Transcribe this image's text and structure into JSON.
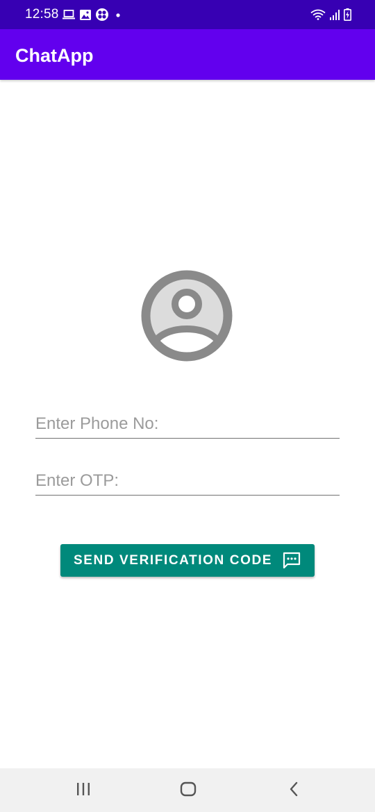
{
  "status_bar": {
    "time": "12:58",
    "left_icons": [
      "laptop-icon",
      "image-icon",
      "app-icon",
      "dot-icon"
    ],
    "right_icons": [
      "wifi-icon",
      "signal-icon",
      "battery-charging-icon"
    ]
  },
  "app_bar": {
    "title": "ChatApp"
  },
  "avatar": {
    "icon": "account-circle-icon"
  },
  "form": {
    "phone_placeholder": "Enter Phone No:",
    "phone_value": "",
    "otp_placeholder": "Enter OTP:",
    "otp_value": ""
  },
  "button": {
    "label": "SEND VERIFICATION CODE",
    "icon": "sms-icon"
  },
  "nav_bar": {
    "buttons": [
      "recents-icon",
      "home-icon",
      "back-icon"
    ]
  },
  "colors": {
    "status_bar": "#3700b3",
    "app_bar": "#6200ee",
    "button": "#00897b",
    "avatar_gray": "#8a8a8a",
    "avatar_fill": "#dcdcdc",
    "nav_bar": "#f1f1f1"
  }
}
